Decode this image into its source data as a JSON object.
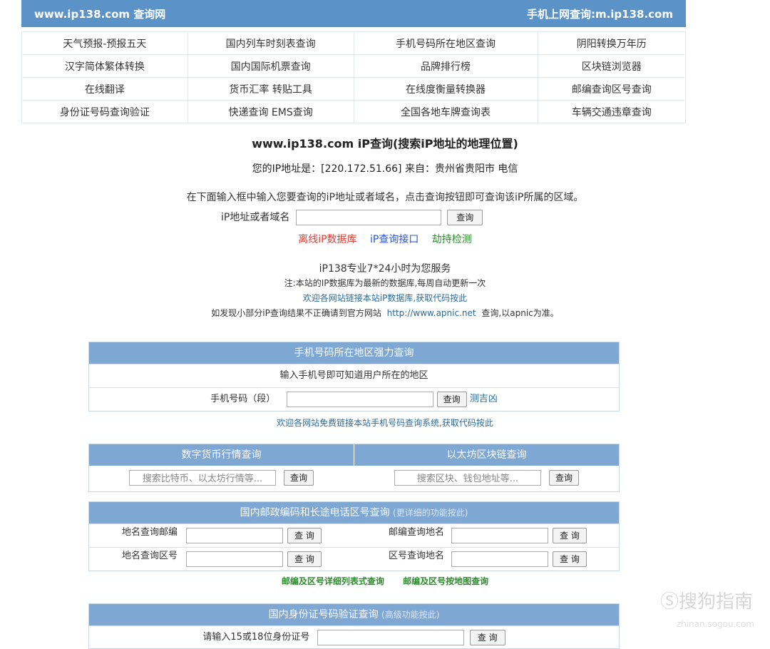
{
  "header": {
    "site": "www.ip138.com 查询网",
    "mobile": "手机上网查询:m.ip138.com"
  },
  "nav": [
    [
      "天气预报-预报五天",
      "国内列车时刻表查询",
      "手机号码所在地区查询",
      "阴阳转换万年历"
    ],
    [
      "汉字简体繁体转换",
      "国内国际机票查询",
      "品牌排行榜",
      "区块链浏览器"
    ],
    [
      "在线翻译",
      "货币汇率 转贴工具",
      "在线度衡量转换器",
      "邮编查询区号查询"
    ],
    [
      "身份证号码查询验证",
      "快递查询 EMS查询",
      "全国各地车牌查询表",
      "车辆交通违章查询"
    ]
  ],
  "main": {
    "title": "www.ip138.com iP查询(搜索iP地址的地理位置)",
    "your_ip": "您的IP地址是：[220.172.51.66] 来自：贵州省贵阳市 电信",
    "hint": "在下面输入框中输入您要查询的iP地址或者域名，点击查询按钮即可查询该iP所属的区域。",
    "ip_label": "iP地址或者域名",
    "query_btn": "查询",
    "links": [
      "离线iP数据库",
      "iP查询接口",
      "劫持检测"
    ],
    "service": "iP138专业7*24小时为您服务",
    "note1": "注:本站的IP数据库为最新的数据库,每周自动更新一次",
    "note2": "欢迎各网站链接本站iP数据库,获取代码按此",
    "note3_pre": "如发现小部分iP查询结果不正确请到官方网站",
    "note3_link": "http://www.apnic.net",
    "note3_post": "查询,以apnic为准。"
  },
  "mobile_panel": {
    "title": "手机号码所在地区强力查询",
    "desc": "输入手机号即可知道用户所在的地区",
    "label": "手机号码（段）",
    "btn": "查询",
    "extra": "测吉凶",
    "footer": "欢迎各网站免费链接本站手机号码查询系统,获取代码按此"
  },
  "crypto_panel": {
    "left_title": "数字货币行情查询",
    "left_placeholder": "搜索比特币、以太坊行情等...",
    "right_title": "以太坊区块链查询",
    "right_placeholder": "搜索区块、钱包地址等...",
    "btn": "查询"
  },
  "postal_panel": {
    "title": "国内邮政编码和长途电话区号查询",
    "title_note": "(更详细的功能按此)",
    "rows": [
      {
        "l_label": "地名查询邮编",
        "r_label": "邮编查询地名"
      },
      {
        "l_label": "地名查询区号",
        "r_label": "区号查询地名"
      }
    ],
    "btn": "查 询",
    "link1": "邮编及区号详细列表式查询",
    "link2": "邮编及区号按地图查询"
  },
  "id_panel": {
    "title": "国内身份证号码验证查询",
    "title_note": "(高级功能按此)",
    "label": "请输入15或18位身份证号",
    "btn": "查 询"
  },
  "watermark": {
    "brand": "Ⓢ搜狗指南",
    "domain": "zhinan.sogou.com"
  },
  "colors": {
    "header_bg": "#5b92c8",
    "panel_head": "#7ea7d3",
    "red_link": "#e03c31",
    "blue_link": "#2a55d6",
    "green_link": "#2e8b2e"
  }
}
